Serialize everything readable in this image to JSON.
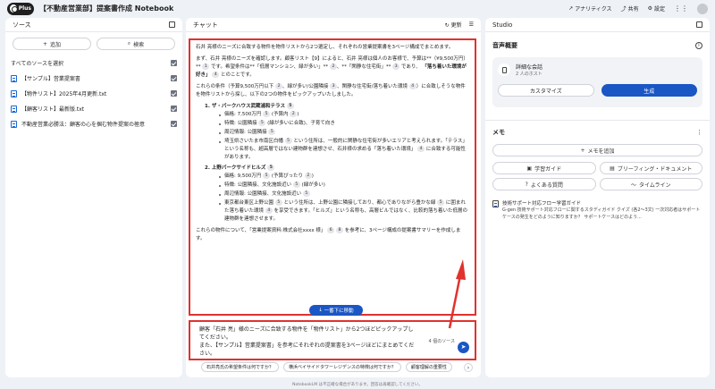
{
  "app": {
    "badge": "Plus",
    "title": "【不動産営業部】提案書作成 Notebook"
  },
  "top_actions": {
    "analytics": "アナリティクス",
    "share": "共有",
    "settings": "設定"
  },
  "sources": {
    "title": "ソース",
    "add": "追加",
    "search": "検索",
    "select_all": "すべてのソースを選択",
    "items": [
      {
        "label": "【サンプル】営業提案書"
      },
      {
        "label": "【物件リスト】2025年4月更新.txt"
      },
      {
        "label": "【顧客リスト】最新版.txt"
      },
      {
        "label": "不動産営業必勝法：顧客の心を掴む物件提案の極意"
      }
    ]
  },
  "chat": {
    "title": "チャット",
    "refresh": "更新",
    "p1": "石井 亮様のニーズに合致する物件を物件リストから2つ選定し、それぞれの営業提案書を3ページ構成でまとめます。",
    "p2a": "まず、石井 亮様のニーズを確認します。顧客リスト【9】によると、石井 亮様は個人のお客様で、予算は**（¥9,500万円）**",
    "p2b": "です。希望条件は**「低層マンション、緑が多い」**",
    "p2c": "、**「閑静な住宅街」**",
    "p2d": "であり、",
    "p2e": "「落ち着いた環境が好き」",
    "p2f": "とのことです。",
    "p3a": "これらの条件（予算9,500万円以下",
    "p3b": "、緑が多い/公園隣接",
    "p3c": "、閑静な住宅街/落ち着いた環境",
    "p3d": "）に合致しそうな物件を物件リストから探し、以下の2つの物件をピックアップいたしました。",
    "prop1": {
      "title": "1. ザ・パークハウス武蔵浦和テラス",
      "price": "価格: 7,500万円",
      "price_note": "(予算内",
      "feature": "特徴: 公園隣接",
      "feature_note": "(緑が多いに合致)、子育て向き",
      "env": "周辺情報: 公園隣接",
      "desc1": "埼玉県さいたま市南区白幡",
      "desc2": "という住所は、一般的に閑静な住宅街が多いエリアと考えられます。「テラス」という名称も、超高層ではない建物群を連想させ、石井様の求める「落ち着いた環境」",
      "desc3": "に合致する可能性があります。"
    },
    "prop2": {
      "title": "2. 上野パークサイドヒルズ",
      "price": "価格: 9,500万円",
      "price_note": "(予算ぴったり",
      "feature": "特徴: 公園隣接、文化施設近い",
      "feature_note": "(緑が多い)",
      "env": "周辺情報: 公園隣接、文化施設近い",
      "desc1": "東京都台東区上野公園",
      "desc2": "という住所は、上野公園に隣接しており、都心でありながら豊かな緑",
      "desc3": "に囲まれた落ち着いた環境",
      "desc4": "を享受できます。「ヒルズ」という名称も、高層ビルではなく、比較的落ち着いた低層の建物群を連想させます。"
    },
    "p4a": "これらの物件について、「営業提案資料:株式会社xxxx 様」",
    "p4b": "を参考に、3ページ構成の提案書サマリーを作成します。",
    "scroll_down": "一番下に移動",
    "input_text": "顧客「石井 亮」様のニーズに合致する物件を「物件リスト」から2つほどピックアップしてください。\nまた、【サンプル】営業提案書」を参考にそれぞれの提案書を3ページほどにまとめてください。",
    "source_count": "4 個のソース",
    "send_icon": "send-icon",
    "suggestions": [
      "石井亮氏の希望条件は何ですか？",
      "横浜ベイサイドタワーレジデンスの特徴は何ですか？",
      "顧客理解の重要性"
    ]
  },
  "cites": [
    "1",
    "2",
    "3",
    "4",
    "5",
    "6",
    "7",
    "8"
  ],
  "studio": {
    "title": "Studio",
    "audio_title": "音声概要",
    "audio_item": "詳細な会話",
    "audio_hosts": "2 人のホスト",
    "customize": "カスタマイズ",
    "generate": "生成",
    "memo_title": "メモ",
    "add_memo": "メモを追加",
    "guides": [
      "学習ガイド",
      "ブリーフィング・ドキュメント",
      "よくある質問",
      "タイムライン"
    ],
    "note_title": "技術サポート対応フロー学習ガイド",
    "note_body": "G-gen 技術サポート対応フローに関するスタディガイド クイズ (各2〜3文) 一次対応者はサポートケースの発生をどのように知りますか？ サポートケースはどのよう..."
  },
  "footer": "NotebookLM は不正確な場合があります。回答は再確認してください。",
  "colors": {
    "accent": "#1a56c4",
    "highlight": "#e0322e"
  }
}
